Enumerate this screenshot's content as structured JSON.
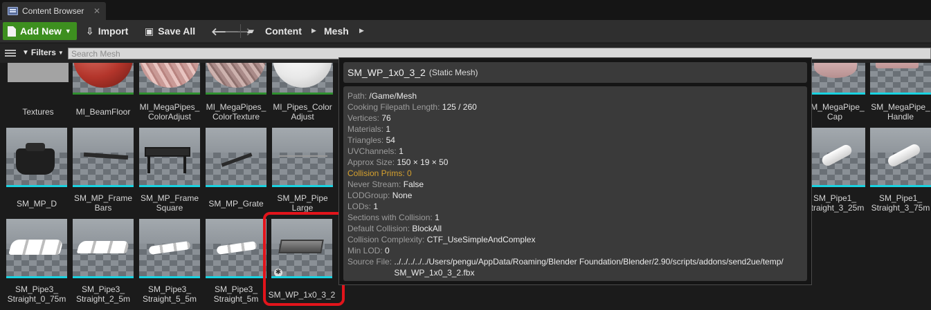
{
  "window": {
    "tab_title": "Content Browser",
    "tab_icon": "content-browser-icon"
  },
  "toolbar": {
    "add_new_label": "Add New",
    "import_label": "Import",
    "save_all_label": "Save All",
    "breadcrumbs": [
      "Content",
      "Mesh"
    ],
    "accent_color": "#3d8f1f"
  },
  "filterbar": {
    "filters_label": "Filters",
    "search_placeholder": "Search Mesh"
  },
  "assets": {
    "row0": [
      {
        "label": "Textures"
      },
      {
        "label": "MI_BeamFloor"
      },
      {
        "label": "MI_MegaPipes_\nColorAdjust"
      },
      {
        "label": "MI_MegaPipes_\nColorTexture"
      },
      {
        "label": "MI_Pipes_Color\nAdjust"
      },
      {
        "label": "SM_MegaPipe_\nCap"
      },
      {
        "label": "SM_MegaPipe_\nHandle"
      }
    ],
    "row1": [
      {
        "label": "SM_MP_D"
      },
      {
        "label": "SM_MP_Frame\nBars"
      },
      {
        "label": "SM_MP_Frame\nSquare"
      },
      {
        "label": "SM_MP_Grate"
      },
      {
        "label": "SM_MP_Pipe\nLarge"
      },
      {
        "label": "SM_Pipe1_\nStraight_3_25m"
      },
      {
        "label": "SM_Pipe1_\nStraight_3_75m"
      }
    ],
    "row2": [
      {
        "label": "SM_Pipe3_\nStraight_0_75m"
      },
      {
        "label": "SM_Pipe3_\nStraight_2_5m"
      },
      {
        "label": "SM_Pipe3_\nStraight_5_5m"
      },
      {
        "label": "SM_Pipe3_\nStraight_5m"
      },
      {
        "label": "SM_WP_1x0_3_2",
        "selected": true
      }
    ],
    "highlight_color": "#e2141b"
  },
  "tooltip": {
    "name": "SM_WP_1x0_3_2",
    "type": "(Static Mesh)",
    "rows": [
      {
        "key": "Path:",
        "value": "/Game/Mesh"
      },
      {
        "key": "Cooking Filepath Length:",
        "value": "125 / 260"
      },
      {
        "key": "Vertices:",
        "value": "76"
      },
      {
        "key": "Materials:",
        "value": "1"
      },
      {
        "key": "Triangles:",
        "value": "54"
      },
      {
        "key": "UVChannels:",
        "value": "1"
      },
      {
        "key": "Approx Size:",
        "value": "150 × 19 × 50"
      },
      {
        "key": "Collision Prims:",
        "value": "0",
        "warn": true
      },
      {
        "key": "Never Stream:",
        "value": "False"
      },
      {
        "key": "LODGroup:",
        "value": "None"
      },
      {
        "key": "LODs:",
        "value": "1"
      },
      {
        "key": "Sections with Collision:",
        "value": "1"
      },
      {
        "key": "Default Collision:",
        "value": "BlockAll"
      },
      {
        "key": "Collision Complexity:",
        "value": "CTF_UseSimpleAndComplex"
      },
      {
        "key": "Min LOD:",
        "value": "0"
      },
      {
        "key": "Source File:",
        "value": "../../../../../Users/pengu/AppData/Roaming/Blender Foundation/Blender/2.90/scripts/addons/send2ue/temp/\nSM_WP_1x0_3_2.fbx"
      }
    ]
  }
}
